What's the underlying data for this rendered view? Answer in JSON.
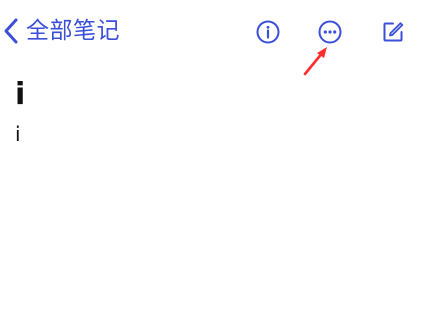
{
  "header": {
    "back_label": "全部笔记",
    "back_icon": "chevron-left-icon",
    "actions": [
      {
        "name": "info",
        "icon": "info-circle-icon"
      },
      {
        "name": "more",
        "icon": "ellipsis-circle-icon"
      },
      {
        "name": "edit",
        "icon": "compose-icon"
      }
    ]
  },
  "note": {
    "title": "i",
    "body": "i"
  },
  "colors": {
    "accent": "#3b4fd8",
    "annotation_arrow": "#ff2d2d",
    "text": "#111111",
    "background": "#ffffff"
  }
}
